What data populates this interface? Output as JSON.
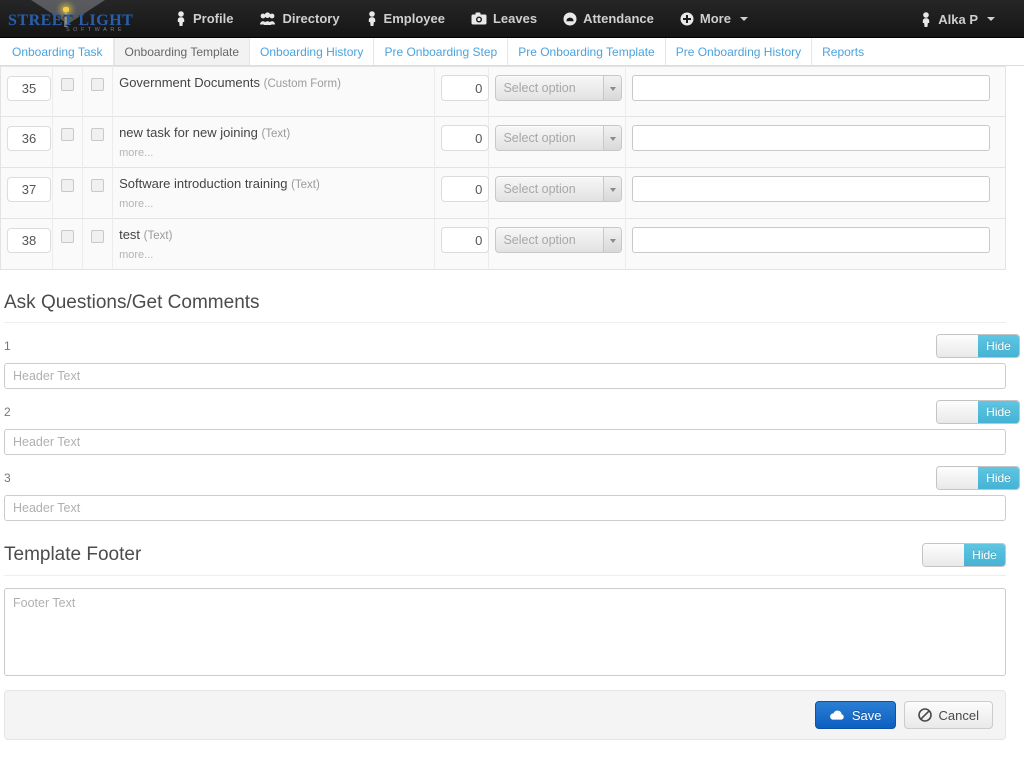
{
  "navbar": {
    "brand": {
      "name": "Street Light",
      "word": "STREET LIGHT",
      "subtitle": "SOFTWARE"
    },
    "items": [
      {
        "label": "Profile",
        "icon": "user-icon"
      },
      {
        "label": "Directory",
        "icon": "users-icon"
      },
      {
        "label": "Employee",
        "icon": "user-icon"
      },
      {
        "label": "Leaves",
        "icon": "camera-icon"
      },
      {
        "label": "Attendance",
        "icon": "circle-badge-icon"
      },
      {
        "label": "More",
        "icon": "plus-circle-icon",
        "caret": true
      }
    ],
    "account": {
      "label": "Alka P",
      "icon": "user-icon",
      "caret": true
    }
  },
  "subnav": {
    "tabs": [
      {
        "label": "Onboarding Task",
        "active": false
      },
      {
        "label": "Onboarding Template",
        "active": true
      },
      {
        "label": "Onboarding History",
        "active": false
      },
      {
        "label": "Pre Onboarding Step",
        "active": false
      },
      {
        "label": "Pre Onboarding Template",
        "active": false
      },
      {
        "label": "Pre Onboarding History",
        "active": false
      },
      {
        "label": "Reports",
        "active": false
      }
    ]
  },
  "task_table": {
    "select_placeholder": "Select option",
    "more_label": "more...",
    "rows": [
      {
        "id": "35",
        "title": "Government Documents",
        "type": "(Custom Form)",
        "more": "",
        "days": "0",
        "select": "Select option",
        "note": ""
      },
      {
        "id": "36",
        "title": "new task for new joining",
        "type": "(Text)",
        "more": "more...",
        "days": "0",
        "select": "Select option",
        "note": ""
      },
      {
        "id": "37",
        "title": "Software introduction training",
        "type": "(Text)",
        "more": "more...",
        "days": "0",
        "select": "Select option",
        "note": ""
      },
      {
        "id": "38",
        "title": "test",
        "type": "(Text)",
        "more": "more...",
        "days": "0",
        "select": "Select option",
        "note": ""
      }
    ]
  },
  "questions_section": {
    "heading": "Ask Questions/Get Comments",
    "header_placeholder": "Header Text",
    "toggle_label": "Hide",
    "items": [
      {
        "number": "1",
        "value": "",
        "toggle": "Hide"
      },
      {
        "number": "2",
        "value": "",
        "toggle": "Hide"
      },
      {
        "number": "3",
        "value": "",
        "toggle": "Hide"
      }
    ]
  },
  "footer_section": {
    "heading": "Template Footer",
    "toggle_label": "Hide",
    "textarea_placeholder": "Footer Text",
    "textarea_value": ""
  },
  "actions": {
    "save_label": "Save",
    "cancel_label": "Cancel",
    "save_icon": "cloud-icon",
    "cancel_icon": "ban-icon"
  },
  "colors": {
    "navbar_bg": "#1b1b1b",
    "tab_link": "#4aa3df",
    "toggle_on": "#45b3d4",
    "save_blue": "#0d5fc0",
    "brand_blue": "#2b5ea8"
  }
}
